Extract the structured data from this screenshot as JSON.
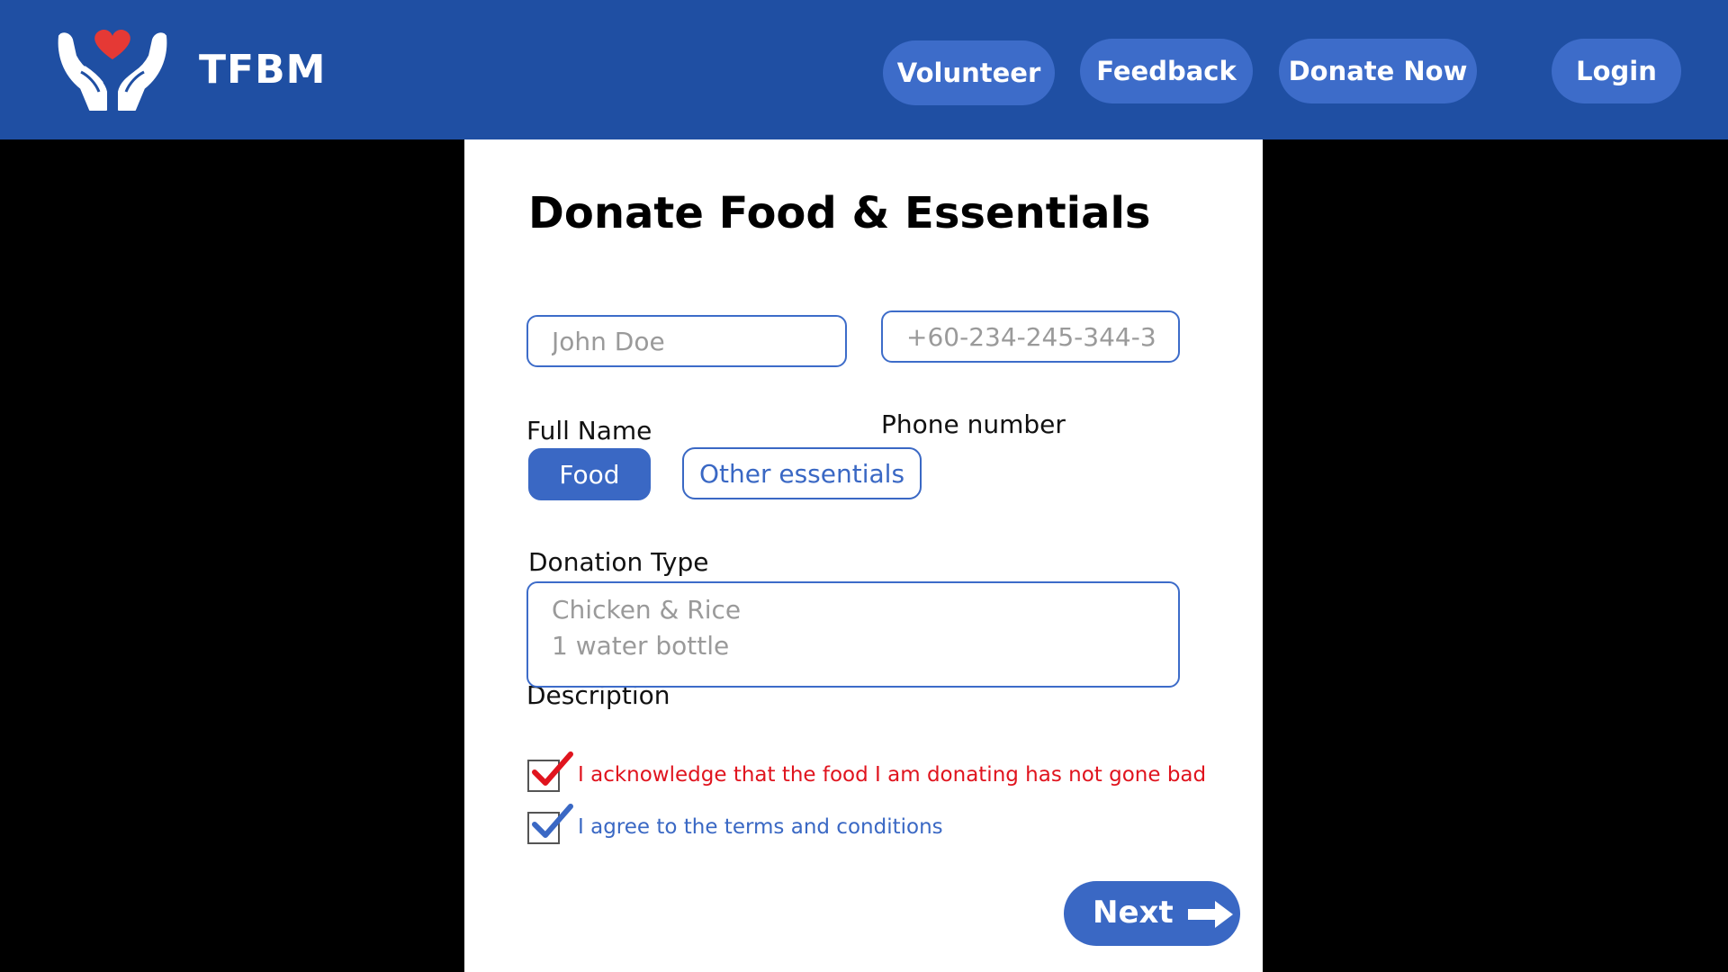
{
  "header": {
    "brand": "TFBM",
    "nav": {
      "volunteer": "Volunteer",
      "feedback": "Feedback",
      "donate_now": "Donate Now",
      "login": "Login"
    }
  },
  "form": {
    "title": "Donate Food & Essentials",
    "full_name": {
      "label": "Full Name",
      "value": "",
      "placeholder": "John Doe"
    },
    "phone": {
      "label": "Phone number",
      "value": "",
      "placeholder": "+60-234-245-344-3"
    },
    "donation_type": {
      "label": "Donation Type",
      "options": [
        "Food",
        "Other essentials"
      ],
      "selected": "Food"
    },
    "description": {
      "label": "Description",
      "value": "",
      "placeholder": "Chicken & Rice\n1 water bottle"
    },
    "checks": [
      {
        "text": "I acknowledge that the food I am donating has not gone bad",
        "checked": true,
        "color": "#e0141e"
      },
      {
        "text": "I agree to the terms and conditions",
        "checked": true,
        "color": "#3a68c4"
      }
    ],
    "next_label": "Next"
  },
  "colors": {
    "header_bg": "#1f4fa3",
    "button_bg": "#3d6cc9",
    "accent": "#3a68c4",
    "heart": "#e53935",
    "warning": "#e0141e"
  },
  "icons": {
    "logo": "hands-holding-heart-icon",
    "next": "arrow-right-icon",
    "check": "checkmark-icon"
  }
}
